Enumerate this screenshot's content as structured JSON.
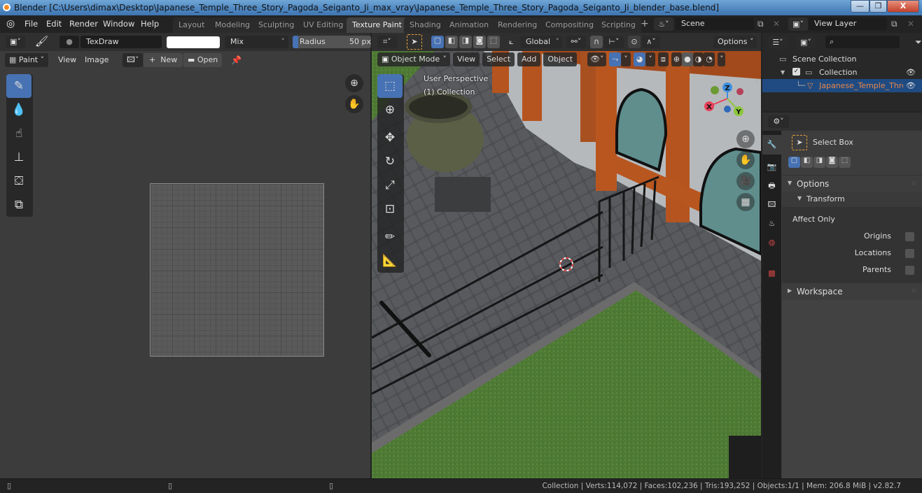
{
  "window": {
    "title": "Blender [C:\\Users\\dimax\\Desktop\\Japanese_Temple_Three_Story_Pagoda_Seiganto_Ji_max_vray\\Japanese_Temple_Three_Story_Pagoda_Seiganto_Ji_blender_base.blend]",
    "controls": {
      "minimize": "—",
      "maximize": "❐",
      "close": "X"
    }
  },
  "menubar": {
    "items": [
      "File",
      "Edit",
      "Render",
      "Window",
      "Help"
    ]
  },
  "workspaces": {
    "tabs": [
      "Layout",
      "Modeling",
      "Sculpting",
      "UV Editing",
      "Texture Paint",
      "Shading",
      "Animation",
      "Rendering",
      "Compositing",
      "Scripting"
    ],
    "active": "Texture Paint",
    "add_label": "+"
  },
  "scene": {
    "value": "Scene"
  },
  "view_layer": {
    "value": "View Layer"
  },
  "image_editor": {
    "brush_name": "TexDraw",
    "color_hex": "#ffffff",
    "blend_mode": "Mix",
    "radius_label": "Radius",
    "radius_value": "50 px",
    "mode_label": "Paint",
    "menu_view": "View",
    "menu_image": "Image",
    "new_label": "New",
    "open_label": "Open",
    "tools": [
      "draw-brush",
      "soften",
      "smear",
      "clone",
      "fill",
      "mask"
    ],
    "active_tool": "draw-brush"
  },
  "viewport": {
    "mode": "Object Mode",
    "menus": [
      "View",
      "Select",
      "Add",
      "Object"
    ],
    "transform_orientation": "Global",
    "options_label": "Options",
    "overlay_text_line1": "User Perspective",
    "overlay_text_line2": "(1) Collection",
    "gizmo_axes": {
      "x": "X",
      "y": "Y",
      "z": "Z"
    },
    "tools": [
      "select-box",
      "cursor",
      "move",
      "rotate",
      "scale",
      "transform",
      "annotate",
      "measure"
    ],
    "active_tool": "select-box",
    "shading_active": "solid"
  },
  "outliner": {
    "search_placeholder": "",
    "rows": [
      {
        "label": "Scene Collection",
        "type": "scene-collection"
      },
      {
        "label": "Collection",
        "type": "collection",
        "checked": true,
        "visible": true
      },
      {
        "label": "Japanese_Temple_Three_",
        "type": "mesh",
        "selected": true,
        "visible": true
      }
    ]
  },
  "properties": {
    "tool_name": "Select Box",
    "panels": {
      "options": "Options",
      "transform": "Transform",
      "affect_only": "Affect Only",
      "checkboxes": [
        {
          "label": "Origins",
          "checked": false
        },
        {
          "label": "Locations",
          "checked": false
        },
        {
          "label": "Parents",
          "checked": false
        }
      ],
      "workspace": "Workspace"
    }
  },
  "statusbar": {
    "text": "Collection | Verts:114,072 | Faces:102,236 | Tris:193,252 | Objects:1/1 | Mem: 206.8 MiB | v2.82.7"
  },
  "colors": {
    "accent_blue": "#4772b3",
    "selected_row": "#1f4b82",
    "object_orange": "#e8874a",
    "axis_x": "#e8405a",
    "axis_y": "#8bc63a",
    "axis_z": "#3d8fe0"
  }
}
